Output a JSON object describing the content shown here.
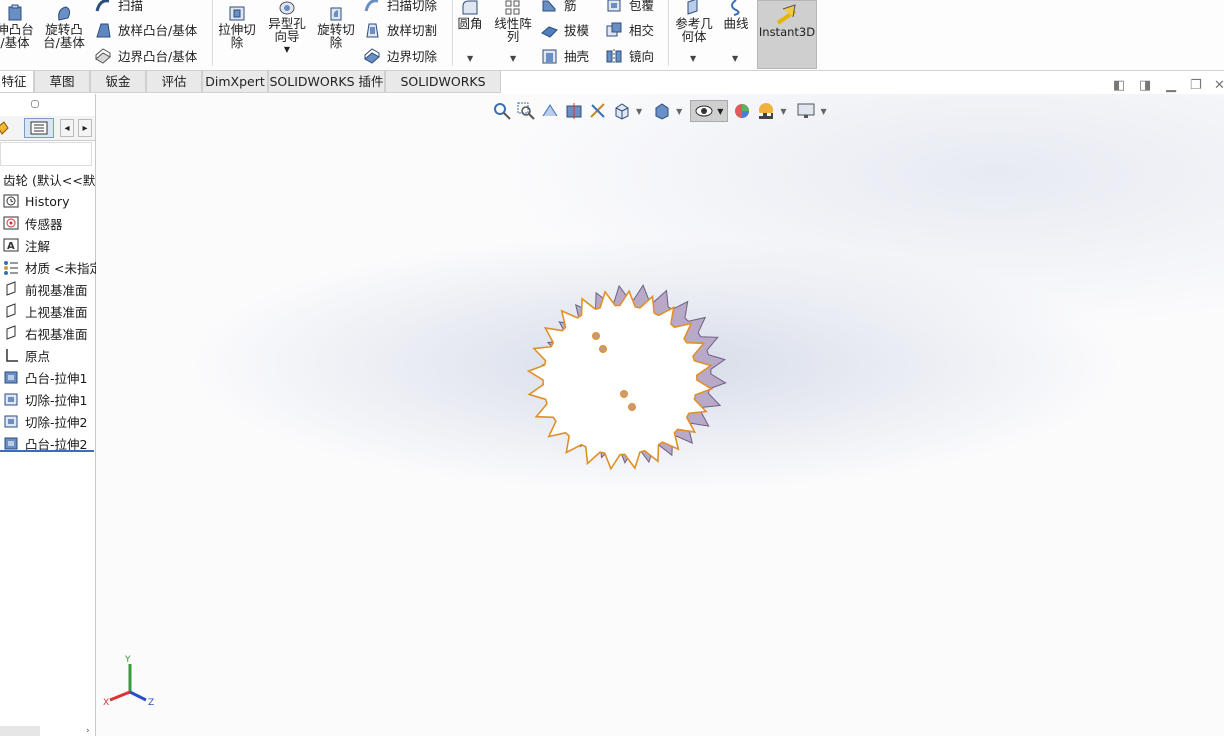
{
  "ribbon": {
    "extrude_boss_l1": "伸凸台",
    "extrude_boss_l2": "/基体",
    "revolve_boss_l1": "旋转凸",
    "revolve_boss_l2": "台/基体",
    "sweep": "扫描",
    "loft_boss": "放样凸台/基体",
    "boundary_boss": "边界凸台/基体",
    "extrude_cut_l1": "拉伸切",
    "extrude_cut_l2": "除",
    "hole_wizard_l1": "异型孔",
    "hole_wizard_l2": "向导",
    "revolve_cut_l1": "旋转切",
    "revolve_cut_l2": "除",
    "sweep_cut": "扫描切除",
    "loft_cut": "放样切割",
    "boundary_cut": "边界切除",
    "fillet": "圆角",
    "linear_pattern_l1": "线性阵",
    "linear_pattern_l2": "列",
    "rib": "筋",
    "draft": "拔模",
    "shell": "抽壳",
    "wrap": "包覆",
    "intersect": "相交",
    "mirror": "镜向",
    "ref_geom_l1": "参考几",
    "ref_geom_l2": "何体",
    "curves": "曲线",
    "instant3d": "Instant3D"
  },
  "tabs": [
    "特征",
    "草图",
    "钣金",
    "评估",
    "DimXpert",
    "SOLIDWORKS 插件",
    "SOLIDWORKS MBD"
  ],
  "tree": {
    "part_name": "齿轮  (默认<<默",
    "items": [
      {
        "label": "History",
        "icon": "history-icon"
      },
      {
        "label": "传感器",
        "icon": "sensor-icon"
      },
      {
        "label": "注解",
        "icon": "annotation-icon"
      },
      {
        "label": "材质 <未指定",
        "icon": "material-icon"
      },
      {
        "label": "前视基准面",
        "icon": "plane-icon"
      },
      {
        "label": "上视基准面",
        "icon": "plane-icon"
      },
      {
        "label": "右视基准面",
        "icon": "plane-icon"
      },
      {
        "label": "原点",
        "icon": "origin-icon"
      },
      {
        "label": "凸台-拉伸1",
        "icon": "extrude-icon"
      },
      {
        "label": "切除-拉伸1",
        "icon": "cut-icon"
      },
      {
        "label": "切除-拉伸2",
        "icon": "cut-icon"
      },
      {
        "label": "凸台-拉伸2",
        "icon": "extrude-icon"
      }
    ]
  },
  "triad": {
    "x": "X",
    "y": "Y",
    "z": "Z"
  },
  "colors": {
    "gear_edge": "#e0902a",
    "gear_side": "#b9a9c9",
    "instant3d_bg": "#cfcfcf"
  }
}
